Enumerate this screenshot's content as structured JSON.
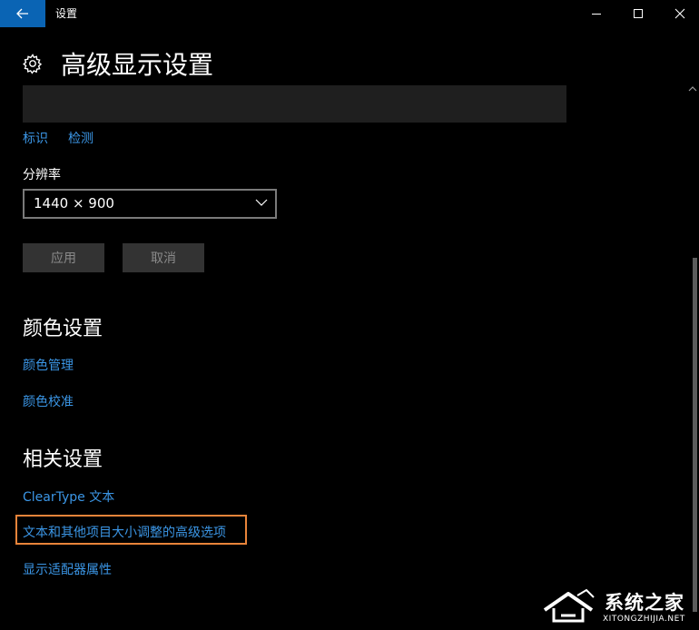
{
  "window": {
    "title": "设置",
    "back_icon": "arrow-left-icon",
    "controls": [
      "minimize-icon",
      "maximize-icon",
      "close-icon"
    ],
    "accent_color": "#0a64b4"
  },
  "header": {
    "icon": "gear-icon",
    "title": "高级显示设置"
  },
  "display": {
    "identify_link": "标识",
    "detect_link": "检测",
    "resolution_label": "分辨率",
    "resolution_value": "1440 × 900",
    "apply_button": "应用",
    "cancel_button": "取消"
  },
  "color_settings": {
    "title": "颜色设置",
    "links": [
      "颜色管理",
      "颜色校准"
    ]
  },
  "related_settings": {
    "title": "相关设置",
    "links": [
      "ClearType 文本",
      "文本和其他项目大小调整的高级选项",
      "显示适配器属性"
    ],
    "highlighted_index": 1,
    "highlight_color": "#e8843a"
  },
  "colors": {
    "link": "#3b96e6",
    "background": "#000000"
  },
  "watermark": {
    "text": "系统之家",
    "subtext": "XITONGZHIJIA.NET"
  }
}
